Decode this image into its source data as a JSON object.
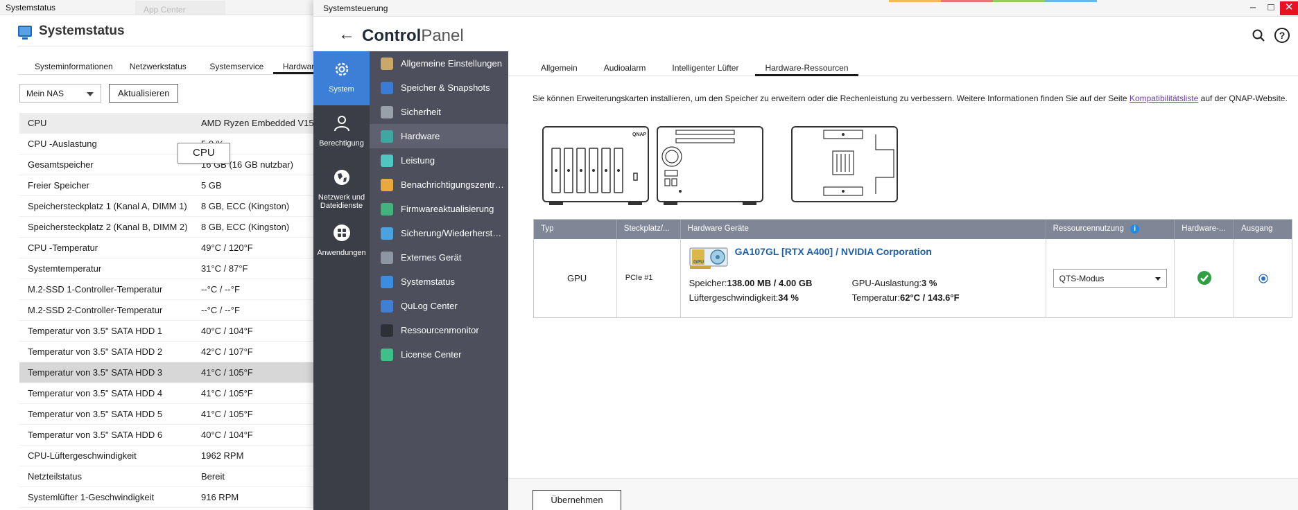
{
  "systemstatus": {
    "window_title": "Systemstatus",
    "ghost_title": "App Center",
    "header_title": "Systemstatus",
    "tabs": [
      "Systeminformationen",
      "Netzwerkstatus",
      "Systemservice",
      "Hardwar"
    ],
    "nas_select": "Mein NAS",
    "refresh_label": "Aktualisieren",
    "tooltip": "CPU",
    "rows": [
      {
        "k": "CPU",
        "v": "AMD Ryzen Embedded V15"
      },
      {
        "k": "CPU -Auslastung",
        "v": "5.0 %"
      },
      {
        "k": "Gesamtspeicher",
        "v": "16 GB (16 GB nutzbar)"
      },
      {
        "k": "Freier Speicher",
        "v": "5 GB"
      },
      {
        "k": "Speichersteckplatz 1 (Kanal A, DIMM 1)",
        "v": "8 GB, ECC (Kingston)"
      },
      {
        "k": "Speichersteckplatz 2 (Kanal B, DIMM 2)",
        "v": "8 GB, ECC (Kingston)"
      },
      {
        "k": "CPU -Temperatur",
        "v": "49°C / 120°F"
      },
      {
        "k": "Systemtemperatur",
        "v": "31°C / 87°F"
      },
      {
        "k": "M.2-SSD 1-Controller-Temperatur",
        "v": "--°C / --°F"
      },
      {
        "k": "M.2-SSD 2-Controller-Temperatur",
        "v": "--°C / --°F"
      },
      {
        "k": "Temperatur von 3.5\" SATA HDD 1",
        "v": "40°C / 104°F"
      },
      {
        "k": "Temperatur von 3.5\" SATA HDD 2",
        "v": "42°C / 107°F"
      },
      {
        "k": "Temperatur von 3.5\" SATA HDD 3",
        "v": "41°C / 105°F"
      },
      {
        "k": "Temperatur von 3.5\" SATA HDD 4",
        "v": "41°C / 105°F"
      },
      {
        "k": "Temperatur von 3.5\" SATA HDD 5",
        "v": "41°C / 105°F"
      },
      {
        "k": "Temperatur von 3.5\" SATA HDD 6",
        "v": "40°C / 104°F"
      },
      {
        "k": "CPU-Lüftergeschwindigkeit",
        "v": "1962 RPM"
      },
      {
        "k": "Netzteilstatus",
        "v": "Bereit"
      },
      {
        "k": "Systemlüfter 1-Geschwindigkeit",
        "v": "916 RPM"
      }
    ]
  },
  "controlpanel": {
    "window_title": "Systemsteuerung",
    "title_bold": "Control",
    "title_light": "Panel",
    "leftnav": [
      {
        "label": "System",
        "icon": "gear-icon"
      },
      {
        "label": "Berechtigung",
        "icon": "user-icon"
      },
      {
        "label": "Netzwerk und Dateidienste",
        "icon": "globe-icon"
      },
      {
        "label": "Anwendungen",
        "icon": "apps-grid-icon"
      }
    ],
    "menu": [
      {
        "label": "Allgemeine Einstellungen",
        "icon": "settings-doc-icon",
        "color": "#c9a86a"
      },
      {
        "label": "Speicher & Snapshots",
        "icon": "storage-icon",
        "color": "#3a7bd5"
      },
      {
        "label": "Sicherheit",
        "icon": "lock-icon",
        "color": "#9aa0aa"
      },
      {
        "label": "Hardware",
        "icon": "hardware-icon",
        "color": "#3fa7a0"
      },
      {
        "label": "Leistung",
        "icon": "power-icon",
        "color": "#4fc6c0"
      },
      {
        "label": "Benachrichtigungszentrum",
        "icon": "notification-icon",
        "color": "#e9a93b"
      },
      {
        "label": "Firmwareaktualisierung",
        "icon": "firmware-icon",
        "color": "#43b27f"
      },
      {
        "label": "Sicherung/Wiederherstellung",
        "icon": "backup-icon",
        "color": "#4aa3df"
      },
      {
        "label": "Externes Gerät",
        "icon": "external-device-icon",
        "color": "#8e96a3"
      },
      {
        "label": "Systemstatus",
        "icon": "monitor-icon",
        "color": "#3a8de0"
      },
      {
        "label": "QuLog Center",
        "icon": "log-search-icon",
        "color": "#3f7fd4"
      },
      {
        "label": "Ressourcenmonitor",
        "icon": "activity-icon",
        "color": "#2e3038"
      },
      {
        "label": "License Center",
        "icon": "license-icon",
        "color": "#3fbf8a"
      }
    ],
    "tabs": [
      "Allgemein",
      "Audioalarm",
      "Intelligenter Lüfter",
      "Hardware-Ressourcen"
    ],
    "desc_before": "Sie können Erweiterungskarten installieren, um den Speicher zu erweitern oder die Rechenleistung zu verbessern. Weitere Informationen finden Sie auf der Seite ",
    "desc_link": "Kompatibilitätsliste",
    "desc_after": " auf der QNAP-Website.",
    "brand_label": "QNAP",
    "table_headers": [
      "Typ",
      "Steckplatz/...",
      "Hardware Geräte",
      "Ressourcennutzung",
      "Hardware-...",
      "Ausgang"
    ],
    "row": {
      "type": "GPU",
      "slot": "PCIe #1",
      "device_name": "GA107GL [RTX A400] / NVIDIA Corporation",
      "gpu_badge": "GPU",
      "mem_label": "Speicher:",
      "mem_value": "138.00 MB / 4.00 GB",
      "load_label": "GPU-Auslastung:",
      "load_value": "3 %",
      "fan_label": "Lüftergeschwindigkeit:",
      "fan_value": "34 %",
      "temp_label": "Temperatur:",
      "temp_value": "62°C / 143.6°F",
      "resource_mode": "QTS-Modus"
    },
    "apply_label": "Übernehmen"
  }
}
